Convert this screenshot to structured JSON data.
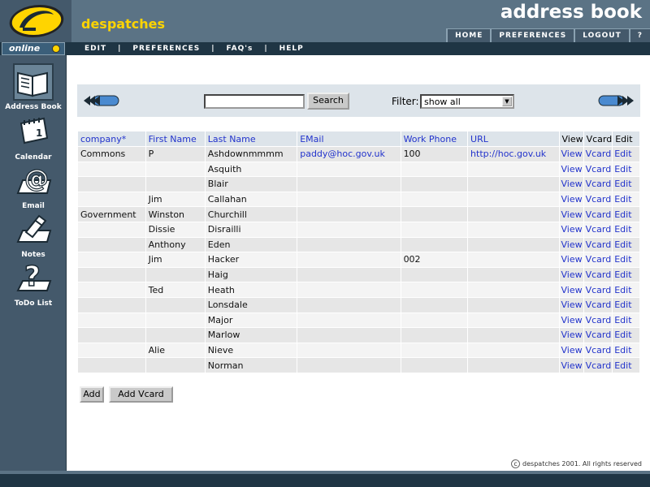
{
  "header": {
    "brand": "despatches",
    "title": "address book",
    "nav": [
      "HOME",
      "PREFERENCES",
      "LOGOUT",
      "?"
    ]
  },
  "status": {
    "online_label": "online"
  },
  "sub_nav": [
    "EDIT",
    "PREFERENCES",
    "FAQ's",
    "HELP"
  ],
  "sidebar": {
    "items": [
      {
        "label": "Address Book",
        "icon": "address-book-icon",
        "selected": true
      },
      {
        "label": "Calendar",
        "icon": "calendar-icon",
        "selected": false
      },
      {
        "label": "Email",
        "icon": "email-icon",
        "selected": false
      },
      {
        "label": "Notes",
        "icon": "notes-icon",
        "selected": false
      },
      {
        "label": "ToDo List",
        "icon": "todo-list-icon",
        "selected": false
      }
    ]
  },
  "toolbar": {
    "search_value": "",
    "search_label": "Search",
    "filter_label": "Filter:",
    "filter_value": "show all"
  },
  "table": {
    "headers": [
      "company*",
      "First Name",
      "Last Name",
      "EMail",
      "Work Phone",
      "URL",
      "View",
      "Vcard",
      "Edit"
    ],
    "rows": [
      [
        "Commons",
        "P",
        "Ashdownmmmm",
        "paddy@hoc.gov.uk",
        "100",
        "http://hoc.gov.uk"
      ],
      [
        "",
        "",
        "Asquith",
        "",
        "",
        ""
      ],
      [
        "",
        "",
        "Blair",
        "",
        "",
        ""
      ],
      [
        "",
        "Jim",
        "Callahan",
        "",
        "",
        ""
      ],
      [
        "Government",
        "Winston",
        "Churchill",
        "",
        "",
        ""
      ],
      [
        "",
        "Dissie",
        "Disrailli",
        "",
        "",
        ""
      ],
      [
        "",
        "Anthony",
        "Eden",
        "",
        "",
        ""
      ],
      [
        "",
        "Jim",
        "Hacker",
        "",
        "002",
        ""
      ],
      [
        "",
        "",
        "Haig",
        "",
        "",
        ""
      ],
      [
        "",
        "Ted",
        "Heath",
        "",
        "",
        ""
      ],
      [
        "",
        "",
        "Lonsdale",
        "",
        "",
        ""
      ],
      [
        "",
        "",
        "Major",
        "",
        "",
        ""
      ],
      [
        "",
        "",
        "Marlow",
        "",
        "",
        ""
      ],
      [
        "",
        "Alie",
        "Nieve",
        "",
        "",
        ""
      ],
      [
        "",
        "",
        "Norman",
        "",
        "",
        ""
      ]
    ],
    "actions": [
      "View",
      "Vcard",
      "Edit"
    ]
  },
  "buttons": {
    "add": "Add",
    "add_vcard": "Add Vcard"
  },
  "footer": {
    "copyright": "despatches 2001. All rights reserved"
  },
  "colors": {
    "header": "#5b7385",
    "sidebar": "#44596b",
    "accent": "#ffd400",
    "link": "#2233cc"
  }
}
